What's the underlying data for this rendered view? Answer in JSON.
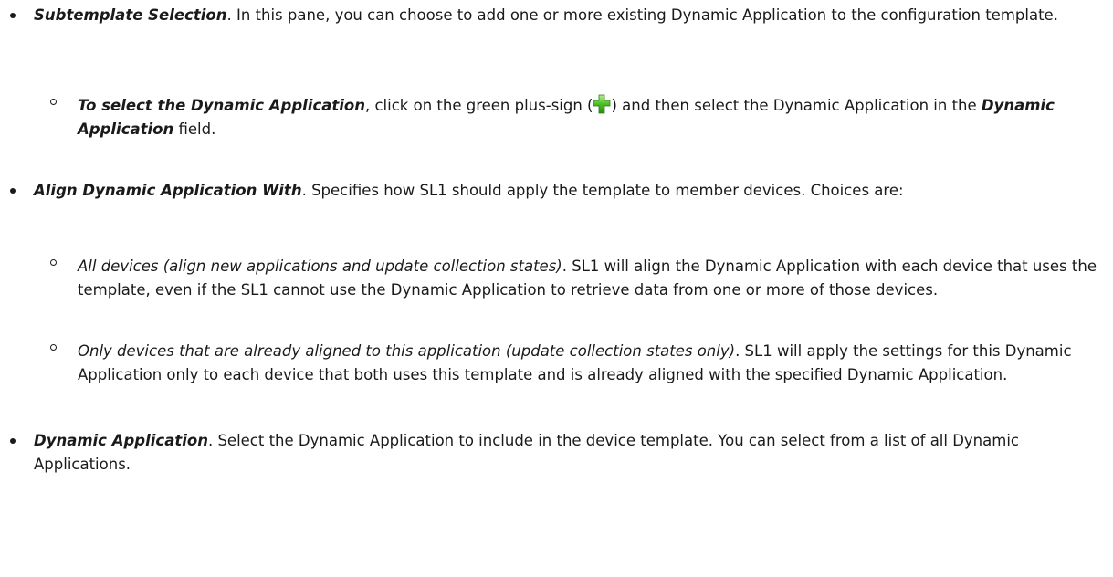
{
  "items": [
    {
      "term": "Subtemplate Selection",
      "text": ". In this pane, you can choose to add one or more existing Dynamic Application to the configuration template.",
      "sub": [
        {
          "term": "To select the Dynamic Application",
          "text_a": ", click on the green plus-sign (",
          "icon": "green-plus-icon",
          "text_b": ") and then select the Dynamic Application in the ",
          "field": "Dynamic Application",
          "text_c": " field."
        }
      ]
    },
    {
      "term": "Align Dynamic Application With",
      "text": ". Specifies how SL1 should apply the template to member devices. Choices are:",
      "sub": [
        {
          "term": "All devices (align new applications and update collection states)",
          "text": ". SL1 will align the Dynamic Application with each device that uses the template, even if the SL1 cannot use the Dynamic Application to retrieve data from one or more of those devices."
        },
        {
          "term": "Only devices that are already aligned to this application (update collection states only)",
          "text": ". SL1 will apply the settings for this Dynamic Application only to each device that both uses this template and is already aligned with the specified Dynamic Application."
        }
      ]
    },
    {
      "term": "Dynamic Application",
      "text": ". Select the Dynamic Application to include in the device template. You can select from a list of all Dynamic Applications."
    }
  ]
}
